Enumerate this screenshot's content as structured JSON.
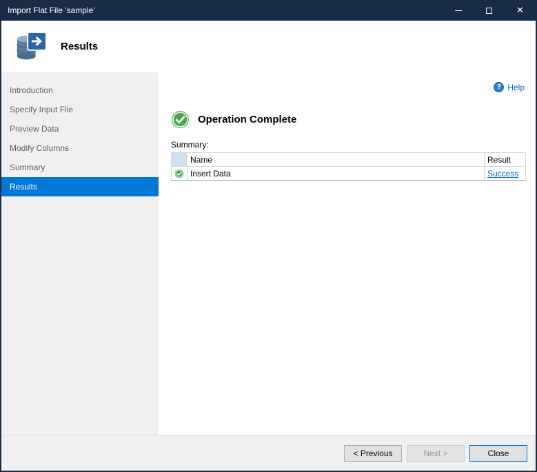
{
  "window": {
    "title": "Import Flat File 'sample'"
  },
  "icons": {
    "close_glyph": "✕",
    "help_glyph": "?"
  },
  "header": {
    "title": "Results"
  },
  "sidebar": {
    "items": [
      {
        "label": "Introduction"
      },
      {
        "label": "Specify Input File"
      },
      {
        "label": "Preview Data"
      },
      {
        "label": "Modify Columns"
      },
      {
        "label": "Summary"
      },
      {
        "label": "Results"
      }
    ],
    "selected_index": 5
  },
  "content": {
    "help_label": "Help",
    "status_title": "Operation Complete",
    "summary_label": "Summary:",
    "table": {
      "headers": {
        "name": "Name",
        "result": "Result"
      },
      "rows": [
        {
          "name": "Insert Data",
          "result": "Success"
        }
      ]
    }
  },
  "footer": {
    "previous": "< Previous",
    "next": "Next >",
    "close": "Close"
  },
  "colors": {
    "titlebar": "#182C46",
    "accent": "#0078D7",
    "success_green": "#4DA64D",
    "link": "#0563C1"
  }
}
